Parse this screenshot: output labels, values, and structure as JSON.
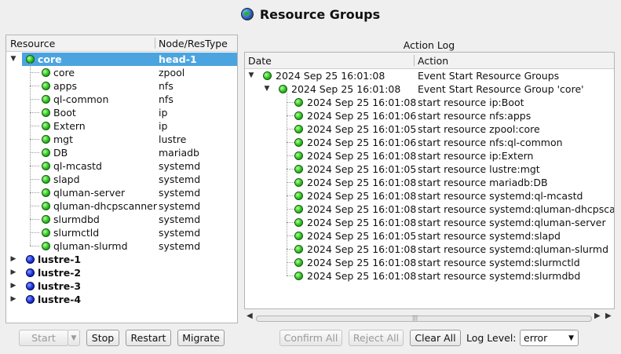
{
  "window": {
    "title": "Resource Groups"
  },
  "tree": {
    "headers": [
      "Resource",
      "Node/ResType"
    ],
    "groups": [
      {
        "name": "core",
        "node": "head-1",
        "expanded": true,
        "status": "green",
        "children": [
          {
            "name": "core",
            "type": "zpool"
          },
          {
            "name": "apps",
            "type": "nfs"
          },
          {
            "name": "ql-common",
            "type": "nfs"
          },
          {
            "name": "Boot",
            "type": "ip"
          },
          {
            "name": "Extern",
            "type": "ip"
          },
          {
            "name": "mgt",
            "type": "lustre"
          },
          {
            "name": "DB",
            "type": "mariadb"
          },
          {
            "name": "ql-mcastd",
            "type": "systemd"
          },
          {
            "name": "slapd",
            "type": "systemd"
          },
          {
            "name": "qluman-server",
            "type": "systemd"
          },
          {
            "name": "qluman-dhcpscanner",
            "type": "systemd"
          },
          {
            "name": "slurmdbd",
            "type": "systemd"
          },
          {
            "name": "slurmctld",
            "type": "systemd"
          },
          {
            "name": "qluman-slurmd",
            "type": "systemd"
          }
        ]
      },
      {
        "name": "lustre-1",
        "node": "",
        "expanded": false,
        "status": "blue"
      },
      {
        "name": "lustre-2",
        "node": "",
        "expanded": false,
        "status": "blue"
      },
      {
        "name": "lustre-3",
        "node": "",
        "expanded": false,
        "status": "blue"
      },
      {
        "name": "lustre-4",
        "node": "",
        "expanded": false,
        "status": "blue"
      }
    ]
  },
  "log": {
    "label": "Action Log",
    "headers": [
      "Date",
      "Action"
    ],
    "root": {
      "date": "2024 Sep 25 16:01:08",
      "action": "Event Start Resource Groups"
    },
    "group": {
      "date": "2024 Sep 25 16:01:08",
      "action": "Event Start Resource Group 'core'"
    },
    "entries": [
      {
        "date": "2024 Sep 25 16:01:08",
        "action": "start resource ip:Boot"
      },
      {
        "date": "2024 Sep 25 16:01:06",
        "action": "start resource nfs:apps"
      },
      {
        "date": "2024 Sep 25 16:01:05",
        "action": "start resource zpool:core"
      },
      {
        "date": "2024 Sep 25 16:01:06",
        "action": "start resource nfs:ql-common"
      },
      {
        "date": "2024 Sep 25 16:01:08",
        "action": "start resource ip:Extern"
      },
      {
        "date": "2024 Sep 25 16:01:05",
        "action": "start resource lustre:mgt"
      },
      {
        "date": "2024 Sep 25 16:01:08",
        "action": "start resource mariadb:DB"
      },
      {
        "date": "2024 Sep 25 16:01:08",
        "action": "start resource systemd:ql-mcastd"
      },
      {
        "date": "2024 Sep 25 16:01:08",
        "action": "start resource systemd:qluman-dhcpscan"
      },
      {
        "date": "2024 Sep 25 16:01:08",
        "action": "start resource systemd:qluman-server"
      },
      {
        "date": "2024 Sep 25 16:01:05",
        "action": "start resource systemd:slapd"
      },
      {
        "date": "2024 Sep 25 16:01:08",
        "action": "start resource systemd:qluman-slurmd"
      },
      {
        "date": "2024 Sep 25 16:01:08",
        "action": "start resource systemd:slurmctld"
      },
      {
        "date": "2024 Sep 25 16:01:08",
        "action": "start resource systemd:slurmdbd"
      }
    ]
  },
  "buttons": {
    "start": "Start",
    "stop": "Stop",
    "restart": "Restart",
    "migrate": "Migrate",
    "confirm_all": "Confirm All",
    "reject_all": "Reject All",
    "clear_all": "Clear All"
  },
  "log_level": {
    "label": "Log Level:",
    "value": "error"
  },
  "colors": {
    "selection": "#4ba4e0",
    "status_green": "#27c21b",
    "status_blue": "#1d2fe0"
  }
}
